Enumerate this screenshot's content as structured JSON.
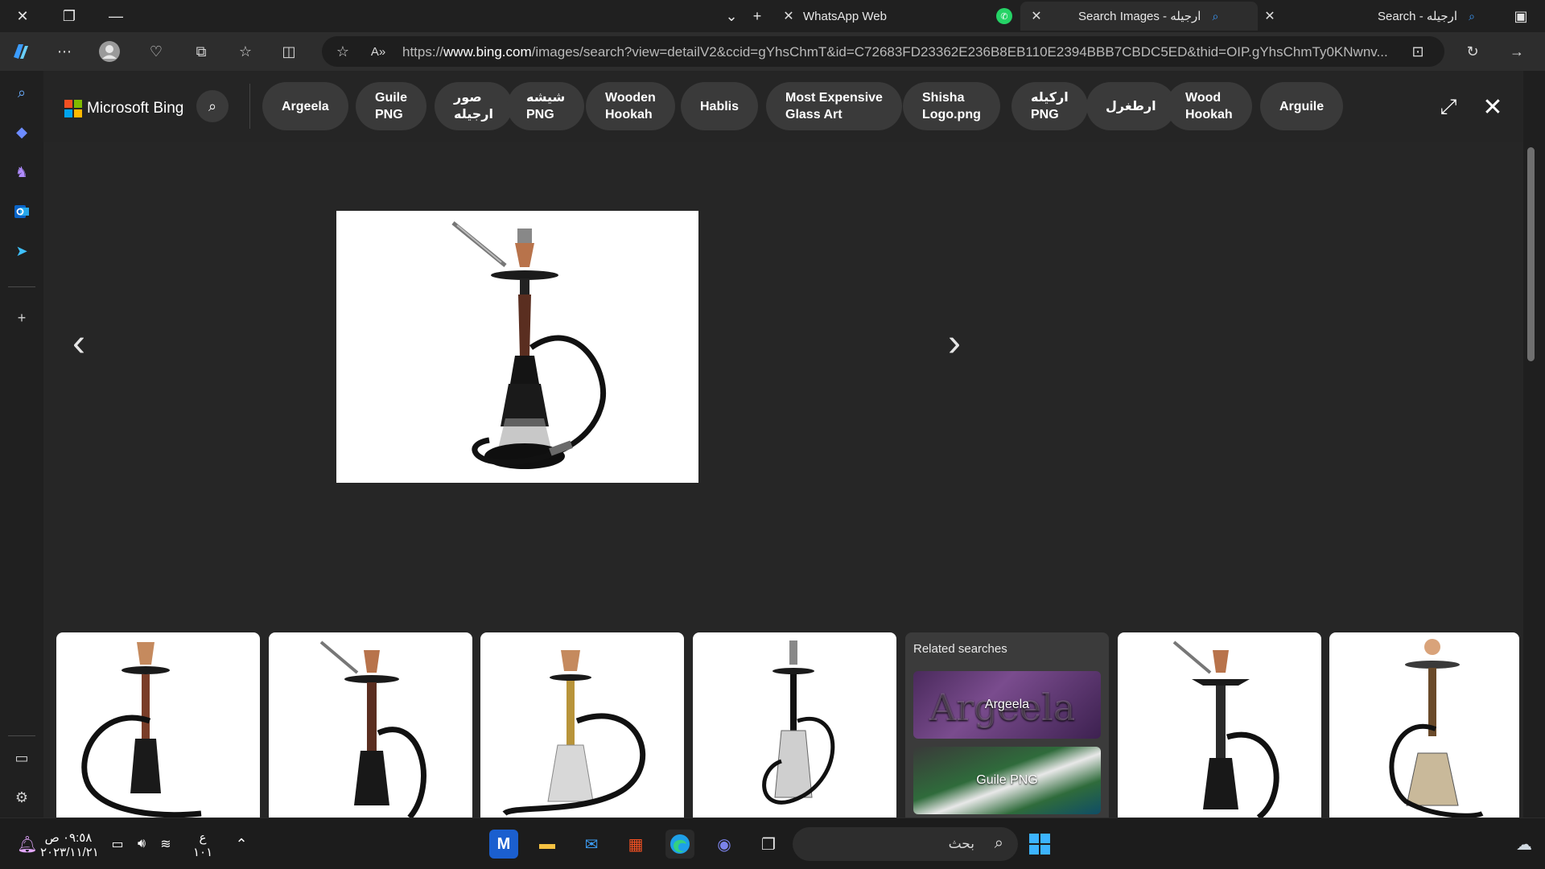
{
  "tabs": [
    {
      "title": "WhatsApp Web",
      "active": false
    },
    {
      "title": "Search Images - ارجيله",
      "active": true
    },
    {
      "title": "Search - ارجيله",
      "active": false
    }
  ],
  "address_bar": {
    "url_prefix": "https://",
    "url_domain": "www.bing.com",
    "url_rest": "/images/search?view=detailV2&ccid=gYhsChmT&id=C72683FD23362E236B8EB110E2394BBB7CBDC5ED&thid=OIP.gYhsChmTy0KNwnv..."
  },
  "bing": {
    "logo_text": "Microsoft Bing",
    "chips": [
      "Argeela",
      "Guile\nPNG",
      "صور\nارجيله",
      "شيشه\nPNG",
      "Wooden\nHookah",
      "Hablis",
      "Most Expensive\nGlass Art",
      "Shisha\nLogo.png",
      "اركيله\nPNG",
      "ارطغرل",
      "Wood\nHookah",
      "Arguile"
    ]
  },
  "related": {
    "title": "Related searches",
    "items": [
      "Argeela",
      "Guile PNG"
    ]
  },
  "taskbar": {
    "search_placeholder": "بحث",
    "time": "٠٩:٥٨ ص",
    "date": "٢٠٢٣/١١/٢١",
    "lang_top": "ع",
    "lang_bottom": "١٠١"
  },
  "colors": {
    "accent": "#3b9cff",
    "whatsapp": "#25d366",
    "overlay_bg": "#262626"
  }
}
